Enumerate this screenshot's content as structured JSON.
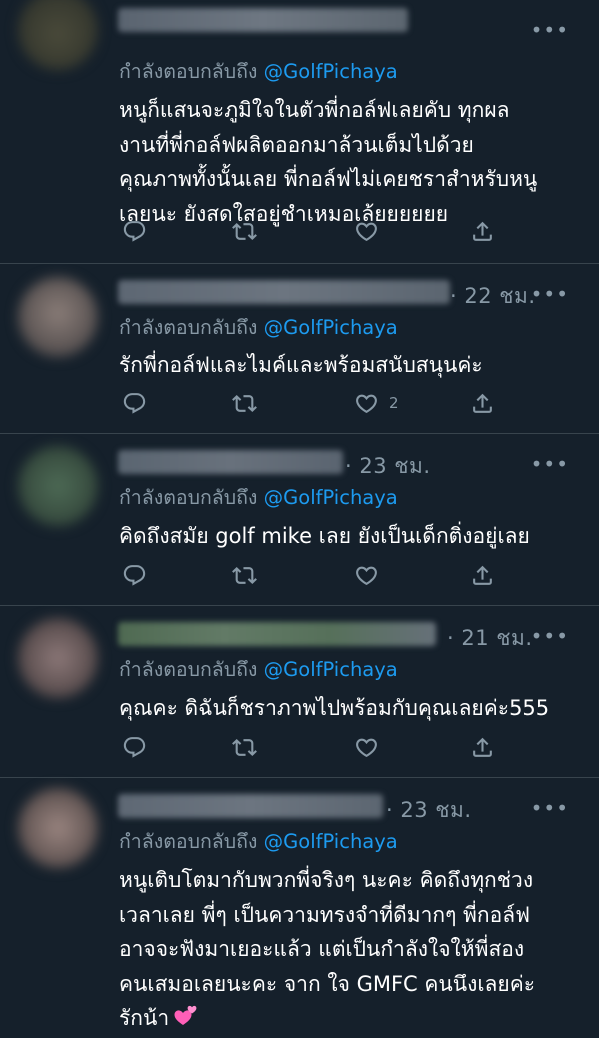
{
  "reply_prefix": "กำลังตอบกลับถึง",
  "reply_handle": "@GolfPichaya",
  "more_label": "•••",
  "icons": {
    "reply": "reply-icon",
    "retweet": "retweet-icon",
    "like": "like-icon",
    "share": "share-icon",
    "more": "more-icon",
    "heart_emoji": "two-hearts-emoji"
  },
  "colors": {
    "background": "#15202b",
    "secondary_text": "#8899a6",
    "link": "#1d9bf0",
    "divider": "#38444d"
  },
  "tweets": [
    {
      "time": "",
      "text": "หนูก็แสนจะภูมิใจในตัวพี่กอล์ฟเลยคับ ทุกผล\nงานที่พี่กอล์ฟผลิตออกมาล้วนเต็มไปด้วย\nคุณภาพทั้งนั้นเลย พี่กอล์ฟไม่เคยชราสำหรับหนู\nเลยนะ ยังสดใสอยู่ชำเหมอเล้ยยยยยย",
      "likes": ""
    },
    {
      "time": "· 22 ชม.",
      "text": "รักพี่กอล์ฟและไมค์และพร้อมสนับสนุนค่ะ",
      "likes": "2"
    },
    {
      "time": "· 23 ชม.",
      "text": "คิดถึงสมัย golf mike เลย ยังเป็นเด็กติ่งอยู่เลย",
      "likes": ""
    },
    {
      "time": "· 21 ชม.",
      "text": "คุณคะ ดิฉันก็ชราภาพไปพร้อมกับคุณเลยค่ะ555",
      "likes": ""
    },
    {
      "time": "· 23 ชม.",
      "text": "หนูเติบโตมากับพวกพี่จริงๆ นะคะ คิดถึงทุกช่วง\nเวลาเลย พี่ๆ เป็นความทรงจำที่ดีมากๆ พี่กอล์ฟ\nอาจจะฟังมาเยอะแล้ว แต่เป็นกำลังใจให้พี่สอง\nคนเสมอเลยนะคะ จาก ใจ GMFC คนนึงเลยค่ะ\nรักน้า",
      "likes": ""
    }
  ]
}
